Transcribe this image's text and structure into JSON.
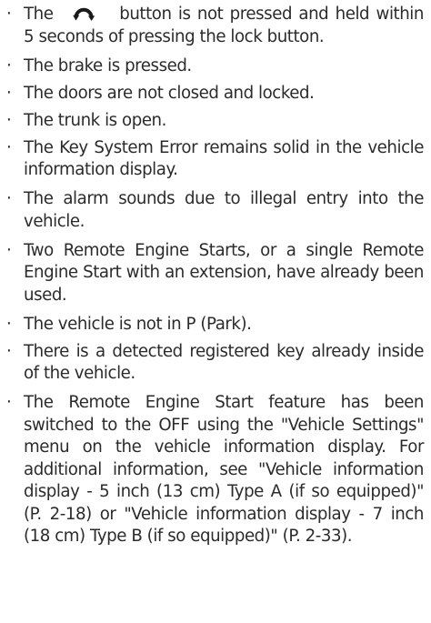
{
  "bullet_char": "·",
  "icon": "remote-start-icon",
  "items": [
    {
      "before_icon": "The",
      "after_icon": "button is not pressed and held within 5 seconds of pressing the lock button."
    },
    {
      "text": "The brake is pressed."
    },
    {
      "text": "The doors are not closed and locked."
    },
    {
      "text": "The trunk is open."
    },
    {
      "text": "The Key System Error remains solid in the vehicle information display."
    },
    {
      "text": "The alarm sounds due to illegal entry into the vehicle."
    },
    {
      "text": "Two Remote Engine Starts, or a single Remote Engine Start with an extension, have already been used."
    },
    {
      "text": "The vehicle is not in P (Park)."
    },
    {
      "text": "There is a detected registered key already inside of the vehicle."
    },
    {
      "text": "The Remote Engine Start feature has been switched to the OFF using the \"Vehicle Settings\" menu on the vehicle information display. For additional information, see \"Vehicle information display - 5 inch (13 cm) Type A (if so equipped)\" (P. 2-18) or \"Vehicle information display - 7 inch (18 cm) Type B (if so equipped)\" (P. 2-33)."
    }
  ]
}
